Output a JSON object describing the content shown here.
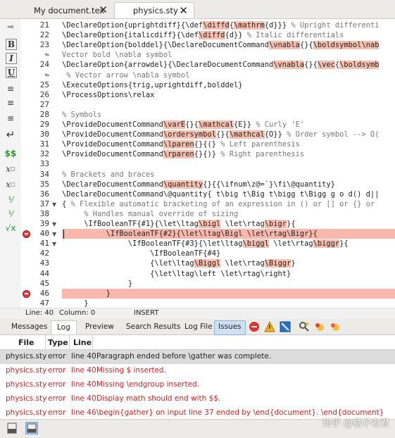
{
  "tabs": [
    {
      "label": "My document.tex"
    },
    {
      "label": "physics.sty"
    }
  ],
  "code": {
    "lines": [
      {
        "n": "21",
        "fold": "",
        "bp": false,
        "indent": "",
        "segs": [
          {
            "t": "\\DeclareOption{uprightdiff}{\\def"
          },
          {
            "t": "\\diffd",
            "h": true
          },
          {
            "t": "{"
          },
          {
            "t": "\\mathrm",
            "h": true
          },
          {
            "t": "{d}}} "
          },
          {
            "t": "% Upright differenti",
            "c": true
          }
        ]
      },
      {
        "n": "22",
        "fold": "",
        "bp": false,
        "indent": "",
        "segs": [
          {
            "t": "\\DeclareOption{italicdiff}{\\def"
          },
          {
            "t": "\\diffd",
            "h": true
          },
          {
            "t": "{d}} "
          },
          {
            "t": "% Italic differentials",
            "c": true
          }
        ]
      },
      {
        "n": "23",
        "fold": "",
        "bp": false,
        "indent": "",
        "segs": [
          {
            "t": "\\DeclareOption{bolddel}{\\DeclareDocumentCommand"
          },
          {
            "t": "\\vnabla",
            "h": true
          },
          {
            "t": "{}{"
          },
          {
            "t": "\\boldsymbol",
            "h": true
          },
          {
            "t": "\\nab",
            "h": true
          }
        ]
      },
      {
        "n": "",
        "fold": "",
        "bp": false,
        "indent": "",
        "segs": [
          {
            "t": "Vector bold \\nabla symbol",
            "c": true
          }
        ]
      },
      {
        "n": "24",
        "fold": "",
        "bp": false,
        "indent": "",
        "segs": [
          {
            "t": "\\DeclareOption{arrowdel}{\\DeclareDocumentCommand"
          },
          {
            "t": "\\vnabla",
            "h": true
          },
          {
            "t": "{}{"
          },
          {
            "t": "\\vec",
            "h": true
          },
          {
            "t": "{"
          },
          {
            "t": "\\boldsymb",
            "h": true
          }
        ]
      },
      {
        "n": "",
        "fold": "",
        "bp": false,
        "indent": " ",
        "segs": [
          {
            "t": "% Vector arrow \\nabla symbol",
            "c": true
          }
        ]
      },
      {
        "n": "25",
        "fold": "",
        "bp": false,
        "indent": "",
        "segs": [
          {
            "t": "\\ExecuteOptions{trig,uprightdiff,bolddel}"
          }
        ]
      },
      {
        "n": "26",
        "fold": "",
        "bp": false,
        "indent": "",
        "segs": [
          {
            "t": "\\ProcessOptions\\relax"
          }
        ]
      },
      {
        "n": "27",
        "fold": "",
        "bp": false,
        "indent": "",
        "segs": []
      },
      {
        "n": "28",
        "fold": "",
        "bp": false,
        "indent": "",
        "segs": [
          {
            "t": "% Symbols",
            "c": true
          }
        ]
      },
      {
        "n": "29",
        "fold": "",
        "bp": false,
        "indent": "",
        "segs": [
          {
            "t": "\\ProvideDocumentCommand"
          },
          {
            "t": "\\varE",
            "h": true
          },
          {
            "t": "{}{"
          },
          {
            "t": "\\mathcal",
            "h": true
          },
          {
            "t": "{E}} "
          },
          {
            "t": "% Curly 'E'",
            "c": true
          }
        ]
      },
      {
        "n": "30",
        "fold": "",
        "bp": false,
        "indent": "",
        "segs": [
          {
            "t": "\\ProvideDocumentCommand"
          },
          {
            "t": "\\ordersymbol",
            "h": true
          },
          {
            "t": "{}{"
          },
          {
            "t": "\\mathcal",
            "h": true
          },
          {
            "t": "{O}} "
          },
          {
            "t": "% Order symbol --> O(",
            "c": true
          }
        ]
      },
      {
        "n": "31",
        "fold": "",
        "bp": false,
        "indent": "",
        "segs": [
          {
            "t": "\\ProvideDocumentCommand"
          },
          {
            "t": "\\lparen",
            "h": true
          },
          {
            "t": "{}{(} "
          },
          {
            "t": "% Left parenthesis",
            "c": true
          }
        ]
      },
      {
        "n": "32",
        "fold": "",
        "bp": false,
        "indent": "",
        "segs": [
          {
            "t": "\\ProvideDocumentCommand"
          },
          {
            "t": "\\rparen",
            "h": true
          },
          {
            "t": "{}{)} "
          },
          {
            "t": "% Right parenthesis",
            "c": true
          }
        ]
      },
      {
        "n": "33",
        "fold": "",
        "bp": false,
        "indent": "",
        "segs": []
      },
      {
        "n": "34",
        "fold": "",
        "bp": false,
        "indent": "",
        "segs": [
          {
            "t": "% Brackets and braces",
            "c": true
          }
        ]
      },
      {
        "n": "35",
        "fold": "",
        "bp": false,
        "indent": "",
        "segs": [
          {
            "t": "\\DeclareDocumentCommand"
          },
          {
            "t": "\\quantity",
            "h": true
          },
          {
            "t": "{}{{\\ifnum\\z@=`}\\fi\\@quantity}"
          }
        ]
      },
      {
        "n": "36",
        "fold": "",
        "bp": false,
        "indent": "",
        "segs": [
          {
            "t": "\\DeclareDocumentCommand\\@quantity{ t\\big t\\Big t\\bigg t\\Bigg g o d() d||"
          }
        ]
      },
      {
        "n": "37",
        "fold": "▼",
        "bp": false,
        "indent": "",
        "segs": [
          {
            "t": "{ "
          },
          {
            "t": "% Flexible automatic bracketing of an expression in () or [] or {} or",
            "c": true
          }
        ]
      },
      {
        "n": "38",
        "fold": "",
        "bp": false,
        "indent": "     ",
        "segs": [
          {
            "t": "% Handles manual override of sizing",
            "c": true
          }
        ]
      },
      {
        "n": "39",
        "fold": "▼",
        "bp": false,
        "indent": "     ",
        "segs": [
          {
            "t": "\\IfBooleanTF{#1}{\\let\\ltag"
          },
          {
            "t": "\\bigl",
            "h": true
          },
          {
            "t": " \\let\\rtag"
          },
          {
            "t": "\\bigr",
            "h": true
          },
          {
            "t": "}{"
          }
        ]
      },
      {
        "n": "40",
        "fold": "▼",
        "bp": true,
        "err": true,
        "cursor": true,
        "indent": "          ",
        "segs": [
          {
            "t": "\\IfBooleanTF{#2}{\\let\\ltag\\Bigl \\let\\rtag\\Bigr}{"
          }
        ]
      },
      {
        "n": "41",
        "fold": "▼",
        "bp": false,
        "indent": "               ",
        "segs": [
          {
            "t": "\\IfBooleanTF{#3}{\\let\\ltag"
          },
          {
            "t": "\\biggl",
            "h": true
          },
          {
            "t": " \\let\\rtag"
          },
          {
            "t": "\\biggr",
            "h": true
          },
          {
            "t": "}{"
          }
        ]
      },
      {
        "n": "42",
        "fold": "",
        "bp": false,
        "indent": "                    ",
        "segs": [
          {
            "t": "\\IfBooleanTF{#4}"
          }
        ]
      },
      {
        "n": "43",
        "fold": "",
        "bp": false,
        "indent": "                    ",
        "segs": [
          {
            "t": "{\\let\\ltag"
          },
          {
            "t": "\\Biggl",
            "h": true
          },
          {
            "t": " \\let\\rtag"
          },
          {
            "t": "\\Biggr",
            "h": true
          },
          {
            "t": "}"
          }
        ]
      },
      {
        "n": "44",
        "fold": "",
        "bp": false,
        "indent": "                    ",
        "segs": [
          {
            "t": "{\\let\\ltag\\left \\let\\rtag\\right}"
          }
        ]
      },
      {
        "n": "45",
        "fold": "",
        "bp": false,
        "indent": "               ",
        "segs": [
          {
            "t": "}"
          }
        ]
      },
      {
        "n": "46",
        "fold": "",
        "bp": true,
        "err": true,
        "indent": "          ",
        "segs": [
          {
            "t": "}"
          }
        ]
      },
      {
        "n": "47",
        "fold": "",
        "bp": false,
        "indent": "     ",
        "segs": [
          {
            "t": "}"
          }
        ]
      }
    ]
  },
  "status": {
    "line": "Line: 40",
    "column": "Column: 0",
    "mode": "INSERT"
  },
  "panel_tabs": [
    {
      "label": "Messages",
      "active": false
    },
    {
      "label": "Log",
      "active": true
    },
    {
      "label": "Preview",
      "active": false
    },
    {
      "label": "Search Results",
      "active": false
    }
  ],
  "log_tabs": {
    "logfile": "Log File",
    "issues": "Issues"
  },
  "table": {
    "headers": {
      "file": "File",
      "type": "Type",
      "line": "Line"
    },
    "rows": [
      {
        "file": "physics.sty",
        "type": "error",
        "line": "line 40",
        "msg": "Paragraph ended before \\gather was complete.",
        "selected": true
      },
      {
        "file": "physics.sty",
        "type": "error",
        "line": "line 40",
        "msg": "Missing $ inserted.",
        "selected": false
      },
      {
        "file": "physics.sty",
        "type": "error",
        "line": "line 40",
        "msg": "Missing \\endgroup inserted.",
        "selected": false
      },
      {
        "file": "physics.sty",
        "type": "error",
        "line": "line 40",
        "msg": "Display math should end with $$.",
        "selected": false
      },
      {
        "file": "physics.sty",
        "type": "error",
        "line": "line 46",
        "msg": "\\begin{gather} on input line 37 ended by \\end{document}. \\end{document}",
        "selected": false
      }
    ]
  },
  "watermark": "知乎 @橘子老君",
  "colors": {
    "highlight": "#f6c0b0",
    "error_band": "#f9b8ae",
    "error_text": "#d42020",
    "breakpoint": "#e04040"
  }
}
